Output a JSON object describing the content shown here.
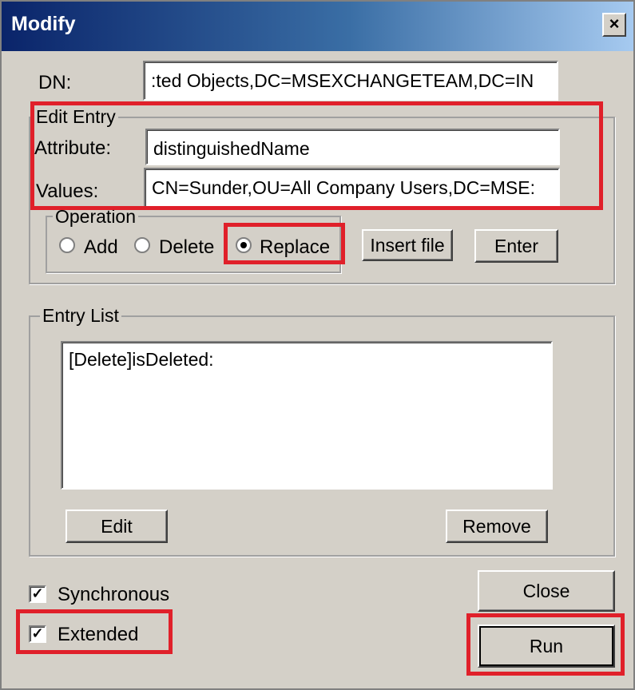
{
  "window": {
    "title": "Modify",
    "close_glyph": "×"
  },
  "dn": {
    "label": "DN:",
    "value": ":ted Objects,DC=MSEXCHANGETEAM,DC=IN"
  },
  "edit_entry": {
    "legend": "Edit Entry",
    "attribute_label": "Attribute:",
    "attribute_value": "distinguishedName",
    "values_label": "Values:",
    "values_value": "CN=Sunder,OU=All Company Users,DC=MSE:"
  },
  "operation": {
    "legend": "Operation",
    "options": [
      {
        "label": "Add",
        "selected": false
      },
      {
        "label": "Delete",
        "selected": false
      },
      {
        "label": "Replace",
        "selected": true
      }
    ]
  },
  "buttons": {
    "insert_file": "Insert file",
    "enter": "Enter",
    "edit": "Edit",
    "remove": "Remove",
    "close": "Close",
    "run": "Run"
  },
  "entry_list": {
    "legend": "Entry List",
    "items": [
      "[Delete]isDeleted:"
    ]
  },
  "options": {
    "synchronous": {
      "label": "Synchronous",
      "checked": true
    },
    "extended": {
      "label": "Extended",
      "checked": true
    }
  },
  "highlight_color": "#e0202a"
}
